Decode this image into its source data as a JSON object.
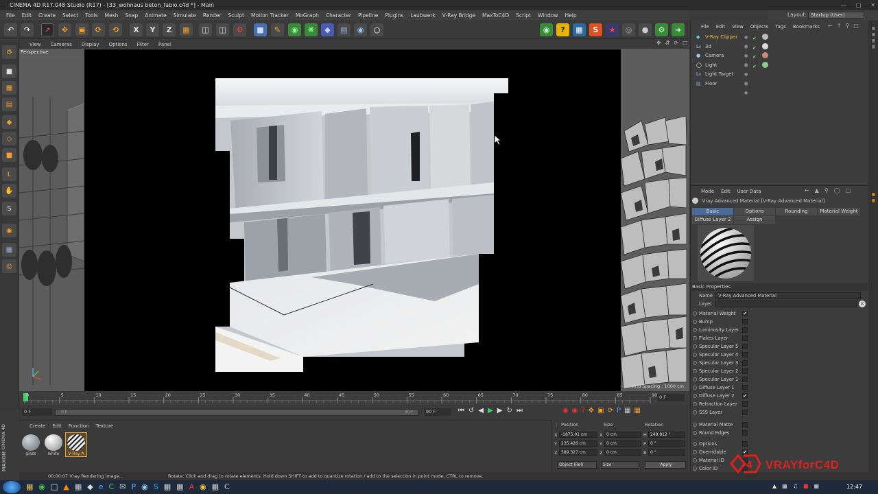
{
  "window": {
    "title": "CINEMA 4D R17.048 Studio (R17) - [33_wohnaus beton_fabio.c4d *] - Main"
  },
  "menu": [
    "File",
    "Edit",
    "Create",
    "Select",
    "Tools",
    "Mesh",
    "Snap",
    "Animate",
    "Simulate",
    "Render",
    "Sculpt",
    "Motion Tracker",
    "MoGraph",
    "Character",
    "Pipeline",
    "Plugins",
    "Laubwerk",
    "V-Ray Bridge",
    "MaxToC4D",
    "Script",
    "Window",
    "Help"
  ],
  "layout": {
    "label": "Layout:",
    "value": "Startup (User)"
  },
  "viewport": {
    "menu": [
      "View",
      "Cameras",
      "Display",
      "Options",
      "Filter",
      "Panel"
    ],
    "label": "Perspective",
    "grid_spacing": "Grid Spacing : 1000 cm"
  },
  "timeline": {
    "ticks": [
      "0",
      "5",
      "10",
      "15",
      "20",
      "25",
      "30",
      "35",
      "40",
      "45",
      "50",
      "55",
      "60",
      "65",
      "70",
      "75",
      "80",
      "85",
      "90"
    ],
    "end_frame": "0 F",
    "start_field": "0 F",
    "slider_start": "0 F",
    "slider_end": "90 F",
    "end_field": "90 F"
  },
  "material_manager": {
    "menu": [
      "Create",
      "Edit",
      "Function",
      "Texture"
    ],
    "materials": [
      {
        "name": "glass",
        "selected": false
      },
      {
        "name": "white",
        "selected": false
      },
      {
        "name": "V-Ray A",
        "selected": true
      }
    ]
  },
  "coord_manager": {
    "headers": [
      "Position",
      "Size",
      "Rotation"
    ],
    "rows": [
      {
        "axis": "X",
        "pos": "-1875.01 cm",
        "size_axis": "X",
        "size": "0 cm",
        "rot_axis": "H",
        "rot": "249.812 °"
      },
      {
        "axis": "Y",
        "pos": "235.426 cm",
        "size_axis": "Y",
        "size": "0 cm",
        "rot_axis": "P",
        "rot": "0 °"
      },
      {
        "axis": "Z",
        "pos": "589.327 cm",
        "size_axis": "Z",
        "size": "0 cm",
        "rot_axis": "B",
        "rot": "0 °"
      }
    ],
    "mode": "Object (Rel)",
    "size_mode": "Size",
    "apply": "Apply"
  },
  "status": {
    "time": "00:00:07 Vray Rendering image...",
    "hint": "Rotate: Click and drag to rotate elements. Hold down SHIFT to add to quantize rotation / add to the selection in point mode, CTRL to remove."
  },
  "object_manager": {
    "menu": [
      "File",
      "Edit",
      "View",
      "Objects",
      "Tags",
      "Bookmarks"
    ],
    "objects": [
      {
        "name": "V-Ray Clipper",
        "highlight": true
      },
      {
        "name": "3d",
        "highlight": false
      },
      {
        "name": "Camera",
        "highlight": false
      },
      {
        "name": "Light",
        "highlight": false
      },
      {
        "name": "Light.Target",
        "highlight": false
      },
      {
        "name": "Floor",
        "highlight": false
      }
    ]
  },
  "attributes": {
    "menu": [
      "Mode",
      "Edit",
      "User Data"
    ],
    "title": "Vray Advanced Material [V-Ray Advanced Material]",
    "tabs_row1": [
      "Basic",
      "Options",
      "Rounding",
      "Material Weight"
    ],
    "tabs_row2": [
      "Diffuse Layer 2",
      "Assign"
    ],
    "section": "Basic Properties",
    "name_label": "Name",
    "name_value": "V-Ray Advanced Material",
    "layer_label": "Layer",
    "props": [
      {
        "label": "Material Weight",
        "checked": true
      },
      {
        "label": "Bump",
        "checked": false
      },
      {
        "label": "Luminosity Layer",
        "checked": false
      },
      {
        "label": "Flakes Layer",
        "checked": false
      },
      {
        "label": "Specular Layer 5",
        "checked": false
      },
      {
        "label": "Specular Layer 4",
        "checked": false
      },
      {
        "label": "Specular Layer 3",
        "checked": false
      },
      {
        "label": "Specular Layer 2",
        "checked": false
      },
      {
        "label": "Specular Layer 1",
        "checked": false
      },
      {
        "label": "Diffuse Layer 1",
        "checked": false
      },
      {
        "label": "Diffuse Layer 2",
        "checked": true
      },
      {
        "label": "Refraction Layer",
        "checked": false
      },
      {
        "label": "SSS Layer",
        "checked": false
      }
    ],
    "props2": [
      {
        "label": "Material Matte",
        "checked": false
      },
      {
        "label": "Round Edges",
        "checked": false
      }
    ],
    "props3": [
      {
        "label": "Options",
        "checked": false
      },
      {
        "label": "Overridable",
        "checked": true
      },
      {
        "label": "Material ID",
        "checked": false
      },
      {
        "label": "Color ID",
        "checked": false
      }
    ]
  },
  "watermark": {
    "text": "VRAYforC4D",
    "accent": "#e0201b"
  },
  "maxon": {
    "brand": "MAXON",
    "product": "CINEMA 4D"
  },
  "taskbar": {
    "clock": "12:47"
  },
  "colors": {
    "accent_orange": "#f0a030",
    "selection_blue": "#4a6a9a",
    "vray_red": "#e0201b"
  }
}
